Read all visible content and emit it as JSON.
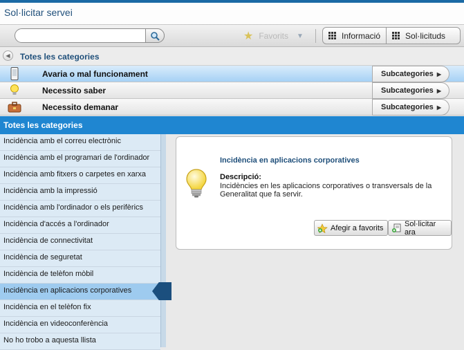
{
  "window": {
    "title": "Sol·licitar servei"
  },
  "toolbar": {
    "search_placeholder": "",
    "favorites_label": "Favorits",
    "buttons": [
      "Informació",
      "Sol·licituds"
    ]
  },
  "breadcrumb": {
    "label": "Totes les categories"
  },
  "categories": [
    {
      "label": "Avaria o mal funcionament",
      "icon": "phone-icon",
      "action": "Subcategories"
    },
    {
      "label": "Necessito saber",
      "icon": "lightbulb-icon",
      "action": "Subcategories"
    },
    {
      "label": "Necessito demanar",
      "icon": "briefcase-icon",
      "action": "Subcategories"
    }
  ],
  "selected_category_index": 0,
  "section": {
    "title": "Totes les categories"
  },
  "list": {
    "items": [
      "Incidència amb el correu electrònic",
      "Incidència amb el programari de l'ordinador",
      "Incidència amb fitxers o carpetes en xarxa",
      "Incidència amb la impressió",
      "Incidència amb l'ordinador o els perifèrics",
      "Incidència d'accés a l'ordinador",
      "Incidència de connectivitat",
      "Incidència de seguretat",
      "Incidència de telèfon mòbil",
      "Incidència en aplicacions corporatives",
      "Incidència en el telèfon fix",
      "Incidència en videoconferència",
      "No ho trobo a aquesta llista"
    ],
    "selected_index": 9
  },
  "detail": {
    "title": "Incidència en aplicacions corporatives",
    "description_label": "Descripció:",
    "description": "Incidències en les aplicacions corporatives o transversals de la Generalitat que fa servir.",
    "buttons": {
      "favorite": "Afegir a favorits",
      "request": "Sol·licitar ara"
    }
  },
  "colors": {
    "accent": "#1f86d1",
    "selected_row": "#a6d1f5",
    "list_bg": "#dceaf5",
    "title_text": "#1f4f7a"
  }
}
